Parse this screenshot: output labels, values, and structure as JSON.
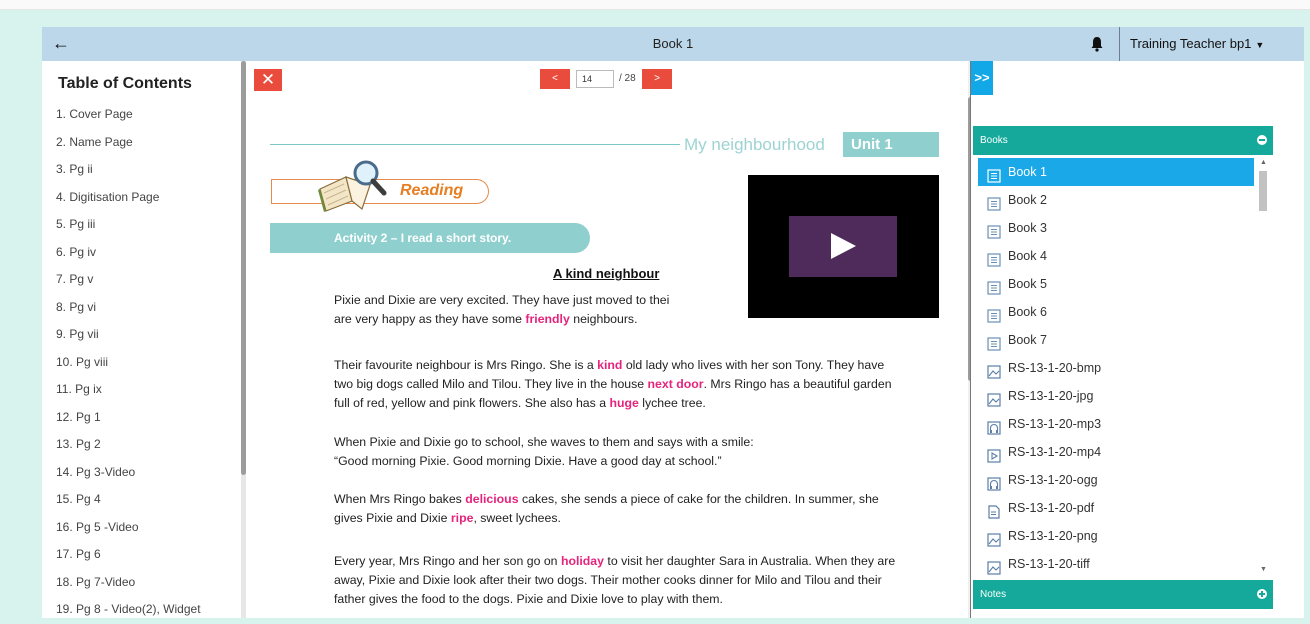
{
  "header": {
    "title": "Book 1",
    "user_name": "Training Teacher bp1"
  },
  "toc": {
    "heading": "Table of Contents",
    "items": [
      "1. Cover Page",
      "2. Name Page",
      "3. Pg ii",
      "4. Digitisation Page",
      "5. Pg iii",
      "6. Pg iv",
      "7. Pg v",
      "8. Pg vi",
      "9. Pg vii",
      "10. Pg viii",
      "11. Pg ix",
      "12. Pg 1",
      "13. Pg 2",
      "14. Pg 3-Video",
      "15. Pg 4",
      "16. Pg 5 -Video",
      "17. Pg 6",
      "18. Pg 7-Video",
      "19. Pg 8 - Video(2), Widget"
    ]
  },
  "pager": {
    "prev_label": "<",
    "next_label": ">",
    "current_page": "14",
    "total_label": "/ 28"
  },
  "page": {
    "unit_title": "My neighbourhood",
    "unit_badge": "Unit 1",
    "section_label": "Reading",
    "activity_label": "Activity 2 – I read a short story.",
    "story_title": "A kind neighbour",
    "paragraphs": [
      [
        {
          "t": "Pixie and Dixie are very excited. They have just moved to thei"
        },
        {
          "br": true
        },
        {
          "t": "are very happy as they have some "
        },
        {
          "t": "friendly",
          "k": true
        },
        {
          "t": " neighbours."
        }
      ],
      [
        {
          "t": "Their favourite neighbour is Mrs Ringo. She is a "
        },
        {
          "t": "kind",
          "k": true
        },
        {
          "t": " old lady who lives with her son Tony. They have two big dogs called Milo and Tilou. They live in the house "
        },
        {
          "t": "next door",
          "k": true
        },
        {
          "t": ". Mrs Ringo has a beautiful garden full of red, yellow and pink flowers. She also has a "
        },
        {
          "t": "huge",
          "k": true
        },
        {
          "t": " lychee tree."
        }
      ],
      [
        {
          "t": "When Pixie and Dixie go to school, she waves to them and says with a smile:"
        },
        {
          "br": true
        },
        {
          "t": "“Good morning Pixie. Good morning Dixie. Have a good day at school.”"
        }
      ],
      [
        {
          "t": "When Mrs Ringo bakes "
        },
        {
          "t": "delicious",
          "k": true
        },
        {
          "t": " cakes, she sends a piece of cake for the children.  In summer, she gives Pixie and Dixie "
        },
        {
          "t": "ripe",
          "k": true
        },
        {
          "t": ", sweet lychees."
        }
      ],
      [
        {
          "t": "Every year, Mrs Ringo and her son go on "
        },
        {
          "t": "holiday",
          "k": true
        },
        {
          "t": " to visit her daughter Sara in Australia. When they are away, Pixie and Dixie look after their two dogs.  Their mother cooks dinner for Milo and Tilou and their father gives the food to the dogs. Pixie and Dixie love to play with them."
        }
      ]
    ]
  },
  "sidebar": {
    "collapse_label": ">>",
    "books_header": "Books",
    "notes_header": "Notes",
    "books": [
      {
        "label": "Book 1",
        "icon": "book-icon",
        "active": true
      },
      {
        "label": "Book 2",
        "icon": "book-icon"
      },
      {
        "label": "Book 3",
        "icon": "book-icon"
      },
      {
        "label": "Book 4",
        "icon": "book-icon"
      },
      {
        "label": "Book 5",
        "icon": "book-icon"
      },
      {
        "label": "Book 6",
        "icon": "book-icon"
      },
      {
        "label": "Book 7",
        "icon": "book-icon"
      },
      {
        "label": "RS-13-1-20-bmp",
        "icon": "image-icon"
      },
      {
        "label": "RS-13-1-20-jpg",
        "icon": "image-icon"
      },
      {
        "label": "RS-13-1-20-mp3",
        "icon": "audio-icon"
      },
      {
        "label": "RS-13-1-20-mp4",
        "icon": "video-icon"
      },
      {
        "label": "RS-13-1-20-ogg",
        "icon": "audio-icon"
      },
      {
        "label": "RS-13-1-20-pdf",
        "icon": "pdf-icon"
      },
      {
        "label": "RS-13-1-20-png",
        "icon": "image-icon"
      },
      {
        "label": "RS-13-1-20-tiff",
        "icon": "image-icon"
      }
    ]
  },
  "colors": {
    "accent_red": "#e94b3c",
    "teal": "#14a99a",
    "header_blue": "#bcd7ea",
    "active_blue": "#1aa8e8",
    "keyword_pink": "#e5247d"
  }
}
